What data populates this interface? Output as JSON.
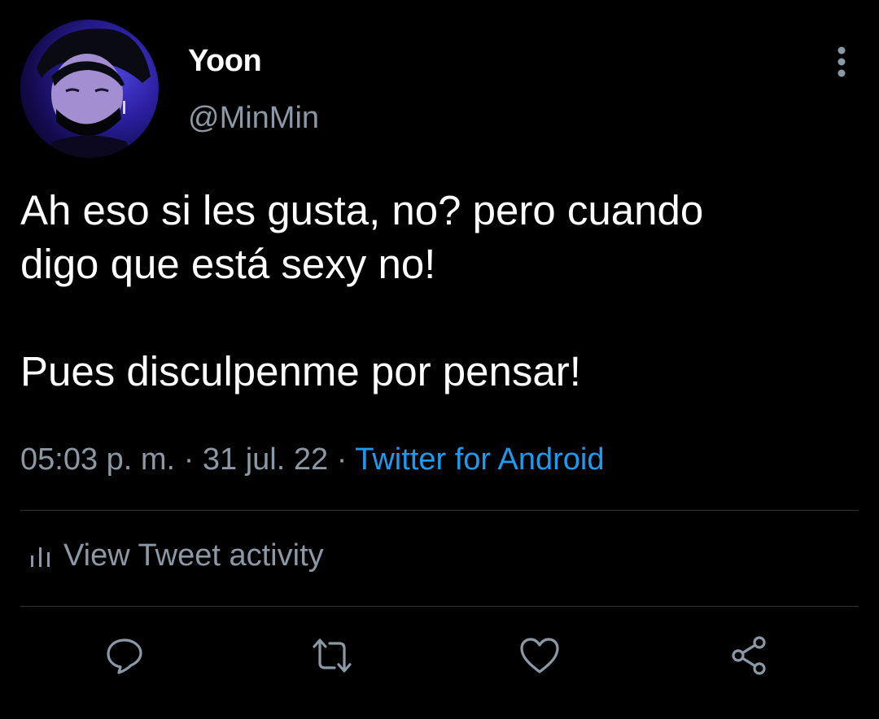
{
  "author": {
    "display_name": "Yoon",
    "handle": "@MinMin",
    "avatar_icon": "profile-photo"
  },
  "tweet": {
    "text": "Ah eso si les gusta, no? pero cuando\ndigo que está sexy no!\n\nPues disculpenme por pensar!",
    "time": "05:03 p. m.",
    "date": "31 jul. 22",
    "separator": "·",
    "source": "Twitter for Android"
  },
  "activity": {
    "label": "View Tweet activity",
    "icon": "bar-chart-icon"
  },
  "actions": [
    {
      "name": "reply",
      "icon": "speech-bubble-icon"
    },
    {
      "name": "retweet",
      "icon": "retweet-icon"
    },
    {
      "name": "like",
      "icon": "heart-icon"
    },
    {
      "name": "share",
      "icon": "share-icon"
    }
  ],
  "colors": {
    "background": "#000000",
    "text_primary": "#ffffff",
    "text_secondary": "#8b98a5",
    "link": "#1d9bf0",
    "divider": "#2f3336"
  }
}
